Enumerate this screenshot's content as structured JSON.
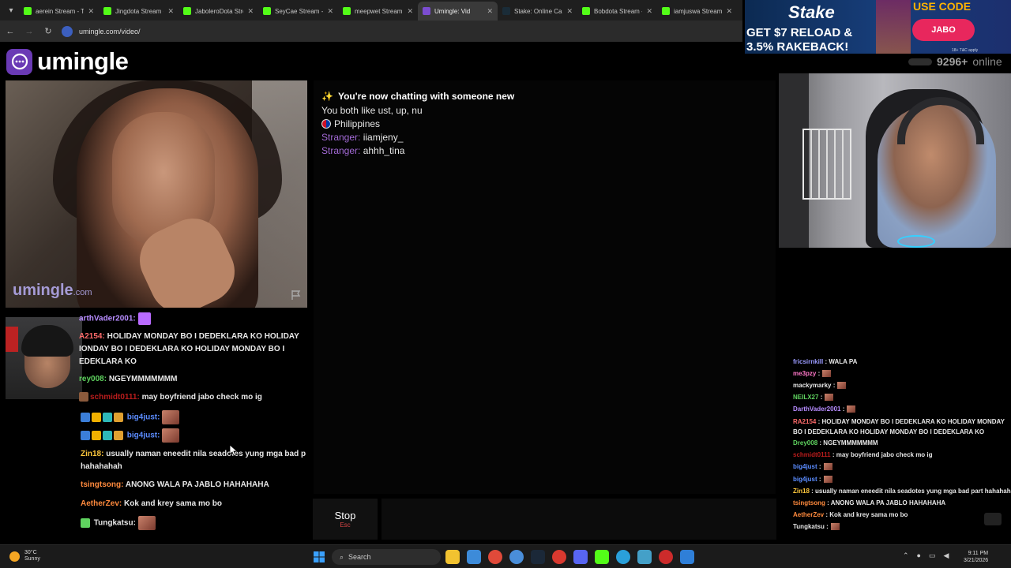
{
  "browser": {
    "tabs": [
      {
        "title": "aerein Stream - Tw",
        "color": "#53fc18",
        "active": false
      },
      {
        "title": "Jingdota Stream - K",
        "color": "#53fc18",
        "active": false
      },
      {
        "title": "JaboleroDota Stream",
        "color": "#53fc18",
        "active": false
      },
      {
        "title": "SeyCae Stream - Ki",
        "color": "#53fc18",
        "active": false
      },
      {
        "title": "meepwet Stream - K",
        "color": "#53fc18",
        "active": false
      },
      {
        "title": "Umingle: Vid",
        "color": "#7b4dd1",
        "active": true
      },
      {
        "title": "Stake: Online Casi",
        "color": "#1a2c38",
        "active": false
      },
      {
        "title": "Bobdota Stream - K",
        "color": "#53fc18",
        "active": false
      },
      {
        "title": "iamjuswa Stream - K",
        "color": "#53fc18",
        "active": false
      }
    ],
    "url": "umingle.com/video/"
  },
  "ad": {
    "logo": "Stake",
    "use_code": "USE CODE",
    "code": "JABO",
    "headline_1": "GET $7 RELOAD &",
    "headline_2": "3.5% RAKEBACK!",
    "fine_print": "18+ T&C apply"
  },
  "site": {
    "logo_text": "umingle",
    "online_count": "9296+",
    "online_label": "online",
    "watermark": "umingle",
    "watermark_suffix": ".com"
  },
  "transcript": {
    "new_chat": "You're now chatting with someone new",
    "common_interests": "You both like ust, up, nu",
    "country": "Philippines",
    "messages": [
      {
        "label": "Stranger:",
        "text": "iiamjeny_"
      },
      {
        "label": "Stranger:",
        "text": "ahhh_tina"
      }
    ]
  },
  "controls": {
    "stop_label": "Stop",
    "stop_key": "Esc",
    "input_placeholder": ""
  },
  "chat_left": [
    {
      "user": "arthVader2001:",
      "text": "",
      "color": "#b78cff"
    },
    {
      "user": "A2154:",
      "text": "HOLIDAY MONDAY BO I DEDEKLARA KO HOLIDAY IONDAY BO I DEDEKLARA KO HOLIDAY MONDAY BO I EDEKLARA KO",
      "color": "#ff6b6b"
    },
    {
      "user": "rey008:",
      "text": "NGEYMMMMMMM",
      "color": "#5fd35f"
    },
    {
      "user": "schmidt0111:",
      "text": "may boyfriend jabo check mo ig",
      "color": "#b91c1c"
    },
    {
      "user": "big4just:",
      "text": "",
      "color": "#5b8cff"
    },
    {
      "user": "big4just:",
      "text": "",
      "color": "#5b8cff"
    },
    {
      "user": "Zin18:",
      "text": "usually naman eneedit nila seadotes yung mga bad p hahahahah",
      "color": "#ffc83d"
    },
    {
      "user": "tsingtsong:",
      "text": "ANONG WALA PA JABLO HAHAHAHA",
      "color": "#ff8a3d"
    },
    {
      "user": "AetherZev:",
      "text": "Kok and krey sama mo bo",
      "color": "#ff8a3d"
    },
    {
      "user": "Tungkatsu:",
      "text": "",
      "color": "#e6e6e6"
    }
  ],
  "chat_right": [
    {
      "user": "fricsirnkill",
      "text": ": WALA PA",
      "color": "#9a9aff"
    },
    {
      "user": "me3pzy",
      "text": ":",
      "color": "#ff77c8"
    },
    {
      "user": "mackymarky",
      "text": ":",
      "color": "#e6e6e6"
    },
    {
      "user": "NEILX27",
      "text": ":",
      "color": "#5fd35f"
    },
    {
      "user": "DarthVader2001",
      "text": ":",
      "color": "#b78cff"
    },
    {
      "user": "RA2154",
      "text": ": HOLIDAY MONDAY BO I DEDEKLARA KO HOLIDAY MONDAY BO I DEDEKLARA KO HOLIDAY MONDAY BO I DEDEKLARA KO",
      "color": "#ff6b6b"
    },
    {
      "user": "Drey008",
      "text": ": NGEYMMMMMMM",
      "color": "#5fd35f"
    },
    {
      "user": "schmidt0111",
      "text": ": may boyfriend jabo check mo ig",
      "color": "#b91c1c"
    },
    {
      "user": "big4just",
      "text": ":",
      "color": "#5b8cff"
    },
    {
      "user": "big4just",
      "text": ":",
      "color": "#5b8cff"
    },
    {
      "user": "Zin18",
      "text": ": usually naman eneedit nila seadotes yung mga bad part hahahahah",
      "color": "#ffc83d"
    },
    {
      "user": "tsingtsong",
      "text": ": ANONG WALA PA JABLO HAHAHAHA",
      "color": "#ff8a3d"
    },
    {
      "user": "AetherZev",
      "text": ": Kok and krey sama mo bo",
      "color": "#ff8a3d"
    },
    {
      "user": "Tungkatsu",
      "text": ":",
      "color": "#e6e6e6"
    }
  ],
  "taskbar": {
    "weather_temp": "30°C",
    "weather_desc": "Sunny",
    "search_placeholder": "Search",
    "time": "9:11 PM",
    "date": "3/21/2026"
  }
}
